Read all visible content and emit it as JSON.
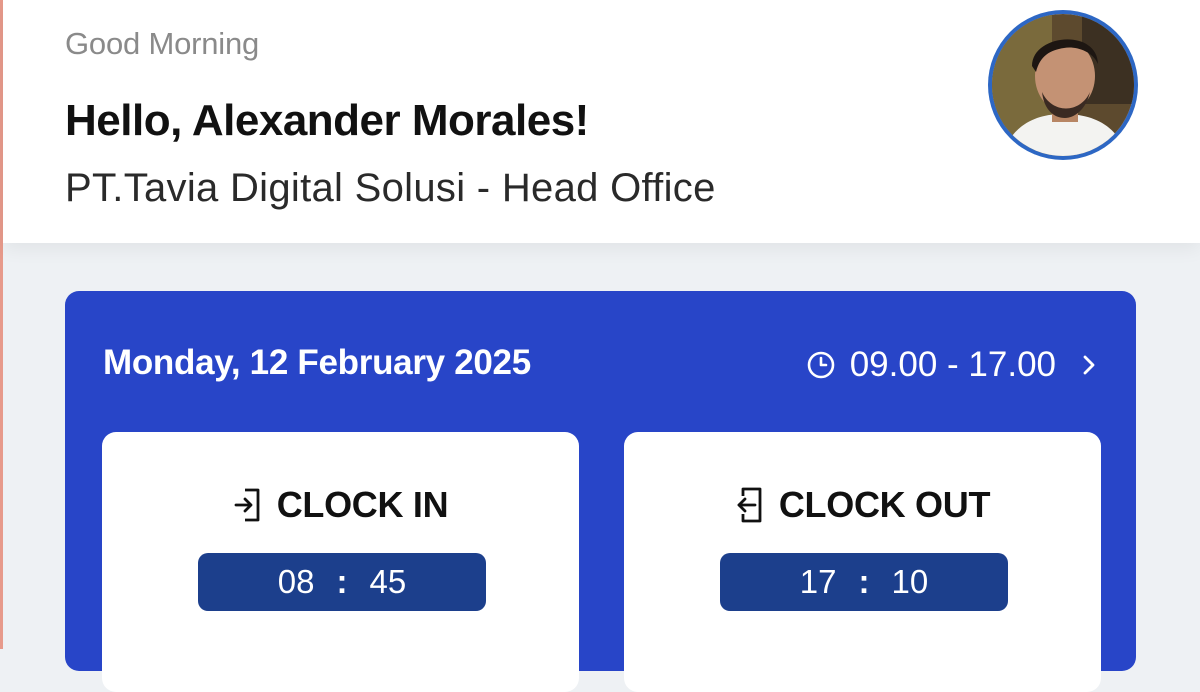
{
  "header": {
    "greeting": "Good Morning",
    "hello": "Hello, Alexander Morales!",
    "company": "PT.Tavia Digital Solusi - Head Office",
    "avatar_icon": "user-avatar"
  },
  "schedule": {
    "date": "Monday, 12 February 2025",
    "shift_time": "09.00 - 17.00",
    "clock_icon": "clock-icon",
    "chevron_icon": "chevron-right-icon"
  },
  "clock_in": {
    "label": "CLOCK IN",
    "icon": "login-icon",
    "hour": "08",
    "separator": ":",
    "minute": "45"
  },
  "clock_out": {
    "label": "CLOCK OUT",
    "icon": "logout-icon",
    "hour": "17",
    "separator": ":",
    "minute": "10"
  },
  "colors": {
    "card_blue": "#2845c8",
    "pill_blue": "#1c3f8c",
    "avatar_ring": "#2d67c4"
  }
}
